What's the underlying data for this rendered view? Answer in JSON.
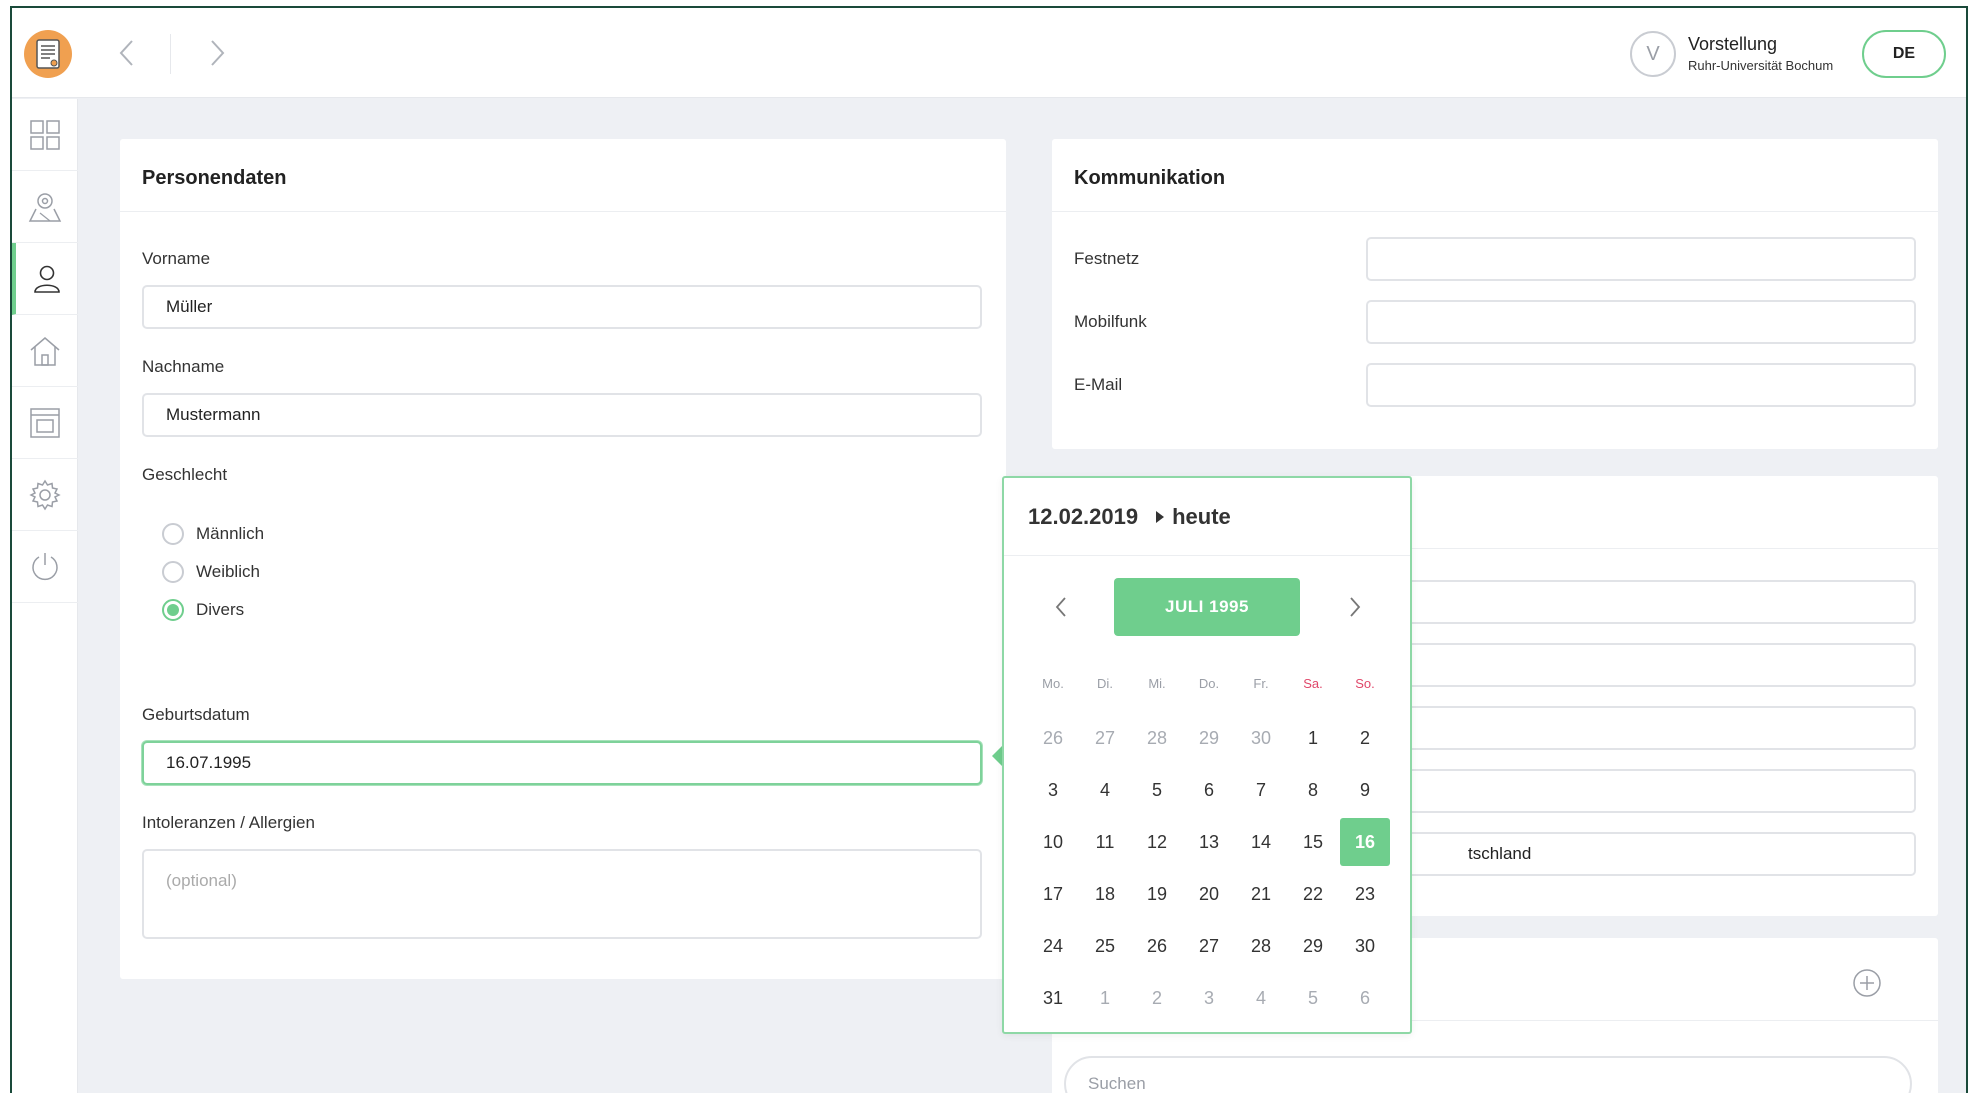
{
  "header": {
    "user_initial": "V",
    "user_name": "Vorstellung",
    "user_org": "Ruhr-Universität Bochum",
    "language": "DE"
  },
  "sidebar": {
    "items": [
      {
        "icon": "dashboard-grid-icon"
      },
      {
        "icon": "map-location-icon"
      },
      {
        "icon": "person-icon",
        "active": true
      },
      {
        "icon": "home-icon"
      },
      {
        "icon": "calendar-window-icon"
      },
      {
        "icon": "gear-icon"
      },
      {
        "icon": "power-icon"
      }
    ]
  },
  "personal": {
    "title": "Personendaten",
    "firstname_label": "Vorname",
    "firstname_value": "Müller",
    "lastname_label": "Nachname",
    "lastname_value": "Mustermann",
    "gender_label": "Geschlecht",
    "gender_options": [
      "Männlich",
      "Weiblich",
      "Divers"
    ],
    "gender_selected": "Divers",
    "birthdate_label": "Geburtsdatum",
    "birthdate_value": "16.07.1995",
    "allergies_label": "Intoleranzen / Allergien",
    "allergies_placeholder": "(optional)"
  },
  "communication": {
    "title": "Kommunikation",
    "landline_label": "Festnetz",
    "mobile_label": "Mobilfunk",
    "email_label": "E-Mail"
  },
  "address": {
    "country_partial": "tschland"
  },
  "search": {
    "placeholder": "Suchen"
  },
  "datepicker": {
    "today_date": "12.02.2019",
    "today_label": "heute",
    "month_label": "JULI 1995",
    "weekdays": [
      "Mo.",
      "Di.",
      "Mi.",
      "Do.",
      "Fr.",
      "Sa.",
      "So."
    ],
    "weeks": [
      [
        "26",
        "27",
        "28",
        "29",
        "30",
        "1",
        "2"
      ],
      [
        "3",
        "4",
        "5",
        "6",
        "7",
        "8",
        "9"
      ],
      [
        "10",
        "11",
        "12",
        "13",
        "14",
        "15",
        "16"
      ],
      [
        "17",
        "18",
        "19",
        "20",
        "21",
        "22",
        "23"
      ],
      [
        "24",
        "25",
        "26",
        "27",
        "28",
        "29",
        "30"
      ],
      [
        "31",
        "1",
        "2",
        "3",
        "4",
        "5",
        "6"
      ]
    ],
    "selected_day": "16"
  },
  "colors": {
    "accent": "#6fce8d",
    "weekend": "#e0476a",
    "logo": "#f0a050"
  }
}
